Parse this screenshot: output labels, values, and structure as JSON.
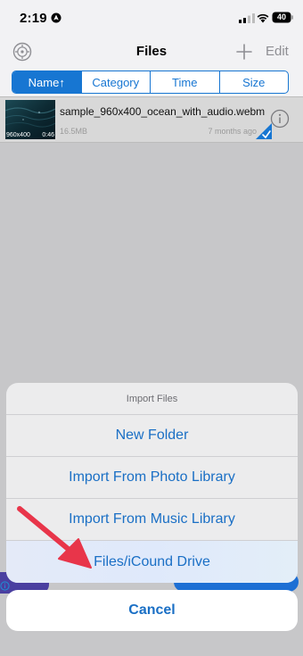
{
  "status": {
    "time": "2:19",
    "battery": "40"
  },
  "nav": {
    "title": "Files",
    "edit_label": "Edit"
  },
  "sort_tabs": [
    {
      "label": "Name↑",
      "active": true
    },
    {
      "label": "Category",
      "active": false
    },
    {
      "label": "Time",
      "active": false
    },
    {
      "label": "Size",
      "active": false
    }
  ],
  "files": [
    {
      "name": "sample_960x400_ocean_with_audio.webm",
      "size": "16.5MB",
      "date": "7 months ago",
      "thumb_resolution": "960x400",
      "thumb_duration": "0:46"
    }
  ],
  "action_sheet": {
    "title": "Import Files",
    "items": [
      "New Folder",
      "Import From Photo Library",
      "Import From Music Library",
      "Files/iCound Drive"
    ],
    "cancel_label": "Cancel"
  },
  "colors": {
    "accent": "#1776d2",
    "sheet_text": "#1a6fc5",
    "arrow": "#e8354a"
  }
}
